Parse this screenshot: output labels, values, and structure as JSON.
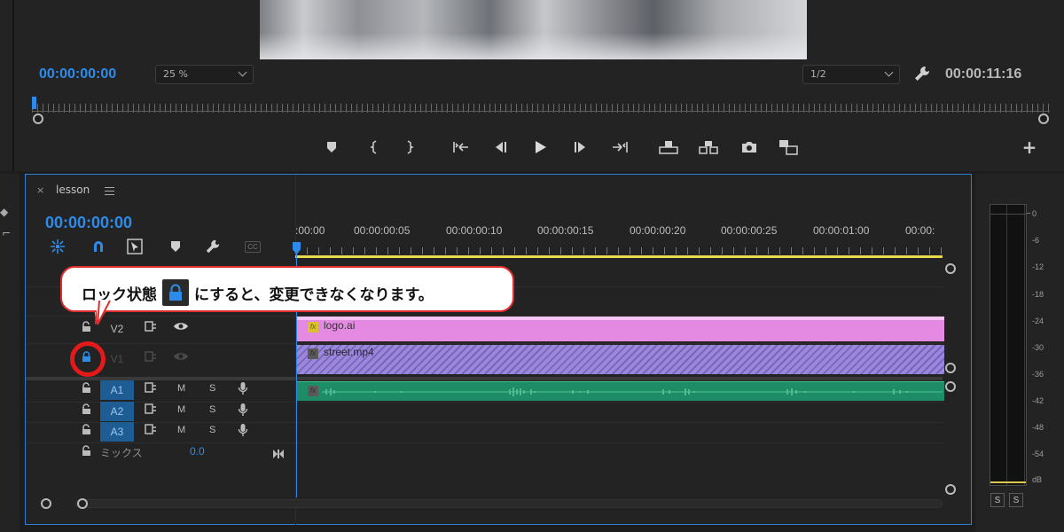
{
  "monitor": {
    "current_time": "00:00:00:00",
    "zoom": "25 %",
    "resolution": "1/2",
    "duration": "00:00:11:16",
    "transport_icons": [
      "marker-icon",
      "mark-in-icon",
      "mark-out-icon",
      "go-to-in-icon",
      "step-back-icon",
      "play-icon",
      "step-forward-icon",
      "go-to-out-icon",
      "lift-icon",
      "extract-icon",
      "camera-icon",
      "comparison-view-icon"
    ],
    "add_button": "+"
  },
  "timeline": {
    "tab_close": "×",
    "sequence_name": "lesson",
    "current_time": "00:00:00:00",
    "tools": [
      "nest-icon",
      "snap-icon",
      "linked-selection-icon",
      "add-marker-icon",
      "settings-wrench-icon",
      "captions-icon"
    ],
    "captions_label": "CC",
    "ruler_labels": [
      ":00:00",
      "00:00:00:05",
      "00:00:00:10",
      "00:00:00:15",
      "00:00:00:20",
      "00:00:00:25",
      "00:00:01:00",
      "00:00:"
    ],
    "tracks": [
      {
        "name": "V2",
        "locked": false
      },
      {
        "name": "V1",
        "locked": true
      },
      {
        "name": "A1",
        "locked": false,
        "m": "M",
        "s": "S"
      },
      {
        "name": "A2",
        "locked": false,
        "m": "M",
        "s": "S"
      },
      {
        "name": "A3",
        "locked": false,
        "m": "M",
        "s": "S"
      }
    ],
    "mix_label": "ミックス",
    "mix_value": "0.0",
    "clips": {
      "logo": "logo.ai",
      "street": "street.mp4"
    },
    "fx_label": "fx"
  },
  "callout": {
    "text_before": "ロック状態",
    "text_after": "にすると、変更できなくなります。"
  },
  "meter": {
    "db_labels": [
      "0",
      "-6",
      "-12",
      "-18",
      "-24",
      "-30",
      "-36",
      "-42",
      "-48",
      "-54",
      "dB"
    ],
    "solo_left": "S",
    "solo_right": "S"
  },
  "colors": {
    "accent": "#2d8ceb",
    "logo_clip": "#e58ae2",
    "video_clip": "#9b88d8",
    "audio_clip": "#1e8c66",
    "callout_border": "#e02e2e"
  }
}
